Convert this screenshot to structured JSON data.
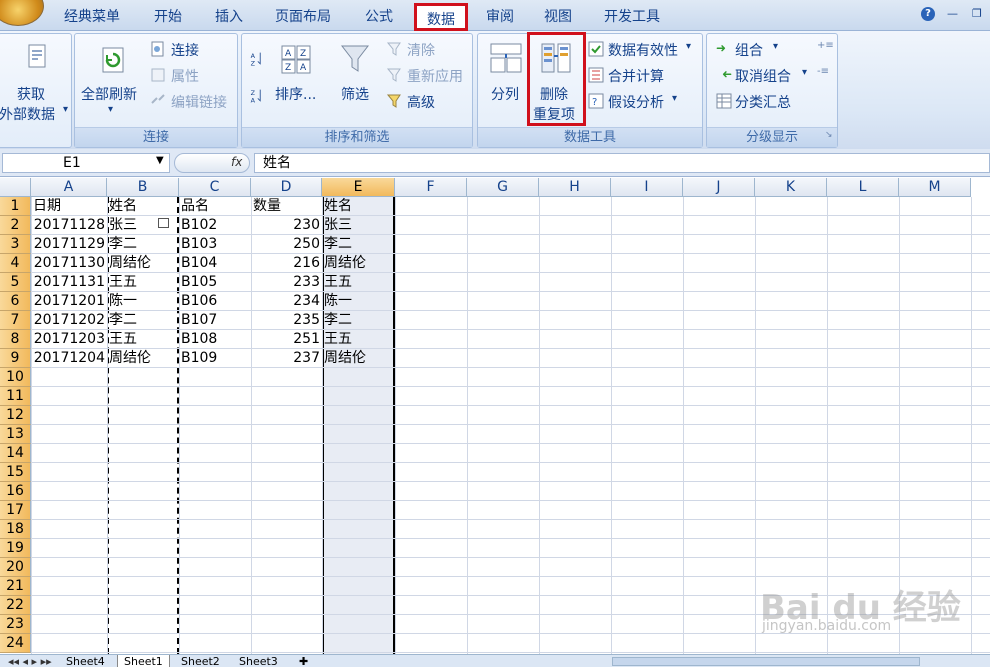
{
  "tabs": [
    "经典菜单",
    "开始",
    "插入",
    "页面布局",
    "公式",
    "数据",
    "审阅",
    "视图",
    "开发工具"
  ],
  "active_tab": "数据",
  "groups": {
    "get_external": {
      "label1": "获取",
      "label2": "外部数据",
      "arrow": "▾"
    },
    "connections": {
      "title": "连接",
      "refresh_all": "全部刷新",
      "connect": "连接",
      "properties": "属性",
      "edit_links": "编辑链接"
    },
    "sort_filter": {
      "title": "排序和筛选",
      "sort": "排序...",
      "filter": "筛选",
      "clear": "清除",
      "reapply": "重新应用",
      "advanced": "高级"
    },
    "data_tools": {
      "title": "数据工具",
      "text_to_columns": "分列",
      "remove_dup1": "删除",
      "remove_dup2": "重复项",
      "validation": "数据有效性",
      "consolidate": "合并计算",
      "what_if": "假设分析"
    },
    "outline": {
      "title": "分级显示",
      "group": "组合",
      "ungroup": "取消组合",
      "subtotal": "分类汇总"
    }
  },
  "formula_bar": {
    "name_box": "E1",
    "fx": "fx",
    "formula": "姓名"
  },
  "columns": [
    "A",
    "B",
    "C",
    "D",
    "E",
    "F",
    "G",
    "H",
    "I",
    "J",
    "K",
    "L",
    "M"
  ],
  "rows": [
    "1",
    "2",
    "3",
    "4",
    "5",
    "6",
    "7",
    "8",
    "9",
    "10",
    "11",
    "12",
    "13",
    "14",
    "15",
    "16",
    "17",
    "18",
    "19",
    "20",
    "21",
    "22",
    "23",
    "24"
  ],
  "table": {
    "headers": [
      "日期",
      "姓名",
      "品名",
      "数量",
      "姓名"
    ],
    "data": [
      [
        "20171128",
        "张三",
        "B102",
        "230",
        "张三"
      ],
      [
        "20171129",
        "李二",
        "B103",
        "250",
        "李二"
      ],
      [
        "20171130",
        "周结伦",
        "B104",
        "216",
        "周结伦"
      ],
      [
        "20171131",
        "王五",
        "B105",
        "233",
        "王五"
      ],
      [
        "20171201",
        "陈一",
        "B106",
        "234",
        "陈一"
      ],
      [
        "20171202",
        "李二",
        "B107",
        "235",
        "李二"
      ],
      [
        "20171203",
        "王五",
        "B108",
        "251",
        "王五"
      ],
      [
        "20171204",
        "周结伦",
        "B109",
        "237",
        "周结伦"
      ]
    ]
  },
  "sheets": [
    "Sheet4",
    "Sheet1",
    "Sheet2",
    "Sheet3"
  ],
  "active_sheet": "Sheet1",
  "watermark": {
    "text": "Bai du 经验",
    "url": "jingyan.baidu.com"
  }
}
